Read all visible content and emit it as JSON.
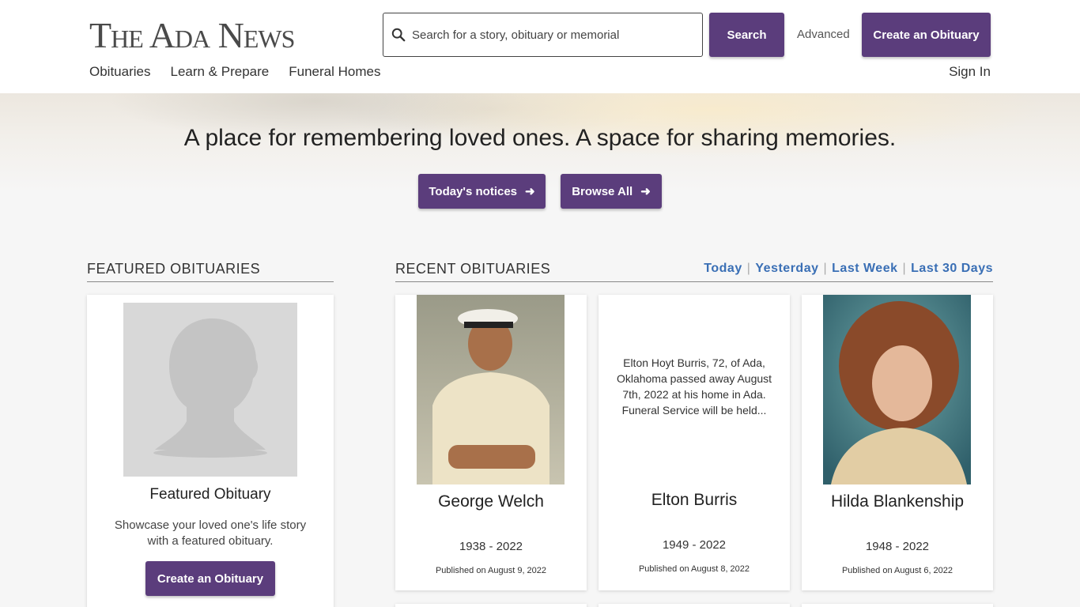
{
  "header": {
    "logo": "The Ada News",
    "search_placeholder": "Search for a story, obituary or memorial",
    "search_label": "Search",
    "advanced_label": "Advanced",
    "create_label": "Create an Obituary",
    "nav": [
      "Obituaries",
      "Learn & Prepare",
      "Funeral Homes"
    ],
    "signin_label": "Sign In"
  },
  "hero": {
    "tagline": "A place for remembering loved ones. A space for sharing memories.",
    "todays_label": "Today's notices",
    "browse_label": "Browse All"
  },
  "featured": {
    "section_title": "FEATURED OBITUARIES",
    "title": "Featured Obituary",
    "description": "Showcase your loved one's life story with a featured obituary.",
    "button_label": "Create an Obituary"
  },
  "recent": {
    "section_title": "RECENT OBITUARIES",
    "filters": [
      "Today",
      "Yesterday",
      "Last Week",
      "Last 30 Days"
    ],
    "items": [
      {
        "name": "George Welch",
        "years": "1938 - 2022",
        "published": "Published on August 9, 2022",
        "excerpt": ""
      },
      {
        "name": "Elton Burris",
        "years": "1949 - 2022",
        "published": "Published on August 8, 2022",
        "excerpt": "Elton Hoyt Burris, 72, of Ada, Oklahoma passed away August 7th, 2022 at his home in Ada. Funeral Service will be held..."
      },
      {
        "name": "Hilda Blankenship",
        "years": "1948 - 2022",
        "published": "Published on August 6, 2022",
        "excerpt": ""
      }
    ]
  },
  "colors": {
    "brand_purple": "#5b3d7c",
    "filter_blue": "#3a6fb5"
  }
}
